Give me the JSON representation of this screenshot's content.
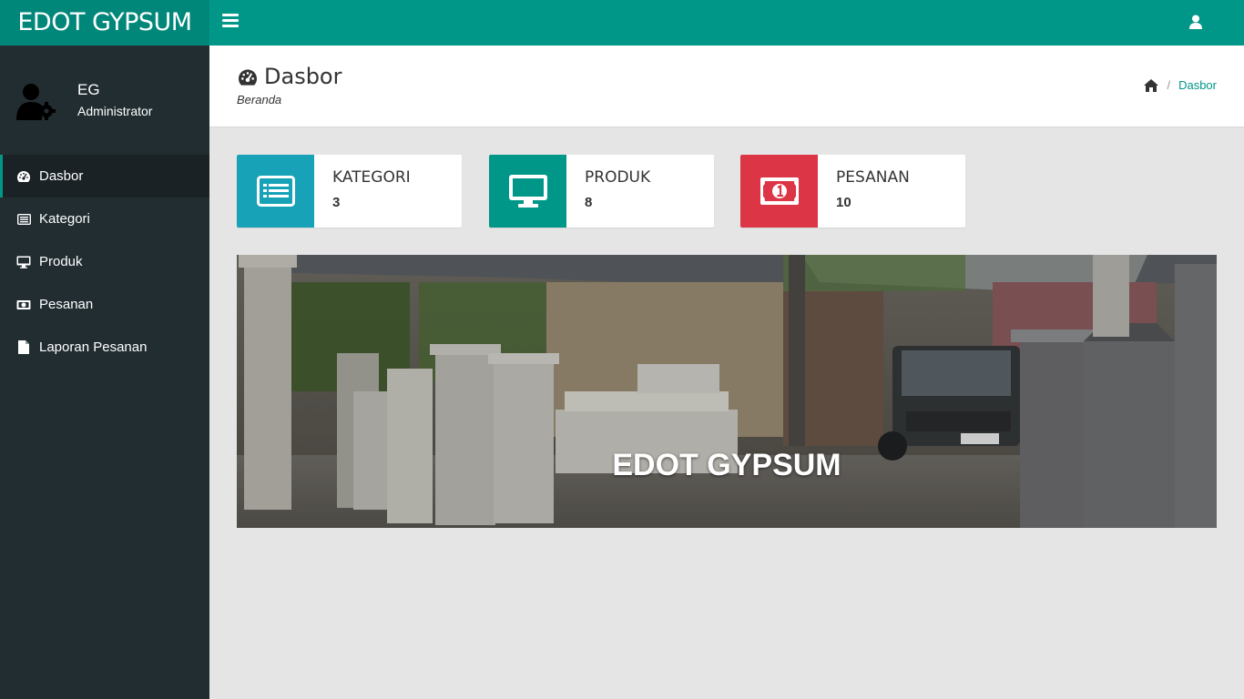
{
  "app": {
    "brand": "EDOT GYPSUM"
  },
  "header": {
    "menu_icon": "bars-icon",
    "user_icon": "user-icon"
  },
  "sidebar": {
    "profile": {
      "name": "EG",
      "role": "Administrator",
      "avatar_icon": "user-gear-icon"
    },
    "items": [
      {
        "label": "Dasbor",
        "icon": "dashboard-icon",
        "active": true
      },
      {
        "label": "Kategori",
        "icon": "list-alt-icon",
        "active": false
      },
      {
        "label": "Produk",
        "icon": "desktop-icon",
        "active": false
      },
      {
        "label": "Pesanan",
        "icon": "money-icon",
        "active": false
      },
      {
        "label": "Laporan Pesanan",
        "icon": "file-icon",
        "active": false
      }
    ]
  },
  "content_header": {
    "title": "Dasbor",
    "subtitle": "Beranda",
    "breadcrumb": {
      "home_icon": "home-icon",
      "current": "Dasbor"
    }
  },
  "info_boxes": [
    {
      "label": "KATEGORI",
      "count": "3",
      "icon": "list-alt-icon",
      "color": "#17a2b8"
    },
    {
      "label": "PRODUK",
      "count": "8",
      "icon": "desktop-icon",
      "color": "#009688"
    },
    {
      "label": "PESANAN",
      "count": "10",
      "icon": "money-icon",
      "color": "#dc3545"
    }
  ],
  "banner": {
    "title": "EDOT GYPSUM"
  },
  "colors": {
    "primary": "#009688",
    "brand_bg": "#00877a",
    "sidebar_bg": "#222d32",
    "content_bg": "#e5e5e5"
  }
}
